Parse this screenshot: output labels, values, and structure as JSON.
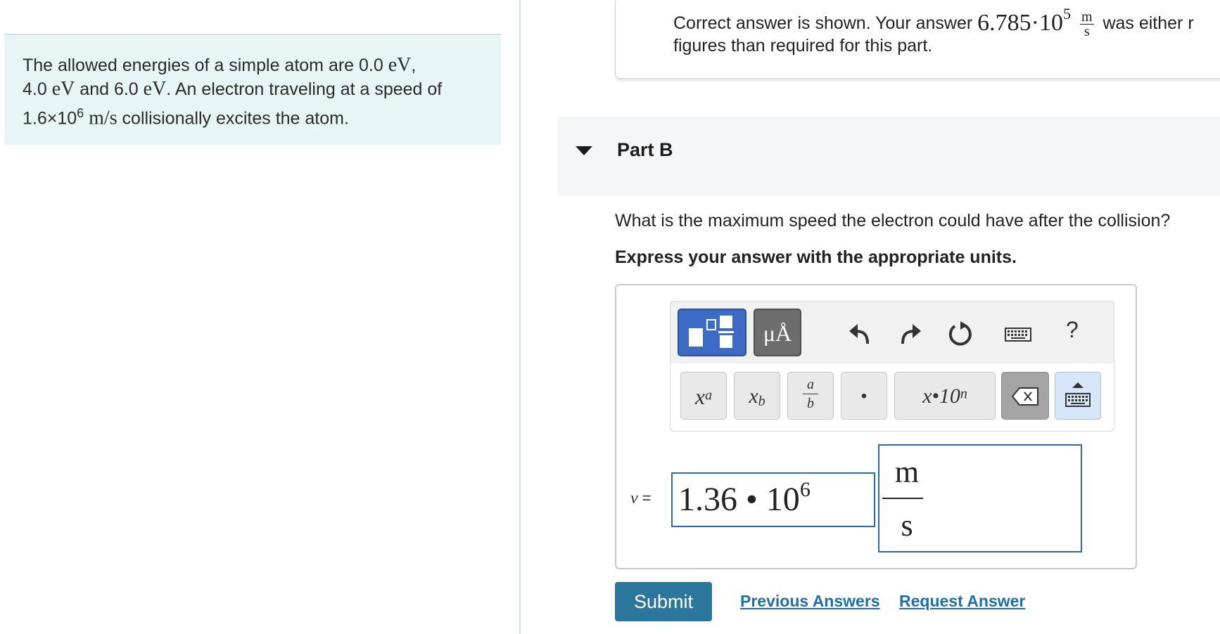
{
  "problem": {
    "text_a": "The allowed energies of a simple atom are 0.0 ",
    "unit_ev": "eV",
    "text_b": ",",
    "text_c": "4.0 ",
    "text_d": " and 6.0 ",
    "text_e": ". An electron traveling at a speed of",
    "speed_base": "1.6×10",
    "speed_exp": "6",
    "speed_unit": "m/s",
    "text_f": " collisionally excites the atom."
  },
  "feedback": {
    "text_prefix": "Correct answer is shown. Your answer ",
    "value_mantissa": "6.785·10",
    "value_exp": "5",
    "unit_num": "m",
    "unit_den": "s",
    "text_suffix": " was either r",
    "line2": "figures than required for this part."
  },
  "part": {
    "title": "Part B"
  },
  "question": "What is the maximum speed the electron could have after the collision?",
  "instruction": "Express your answer with the appropriate units.",
  "toolbar": {
    "units_button": "μÅ",
    "help": "?",
    "keys": {
      "superscript": "x",
      "superscript_sup": "a",
      "subscript": "x",
      "subscript_sub": "b",
      "fraction_num": "a",
      "fraction_den": "b",
      "dot": "•",
      "sci_notation": "x•10",
      "sci_notation_sup": "n"
    }
  },
  "answer": {
    "variable": "v",
    "equals": " =",
    "value_mantissa": "1.36 • 10",
    "value_exp": "6",
    "unit_num": "m",
    "unit_den": "s"
  },
  "actions": {
    "submit": "Submit",
    "previous_answers": "Previous Answers",
    "request_answer": "Request Answer"
  }
}
